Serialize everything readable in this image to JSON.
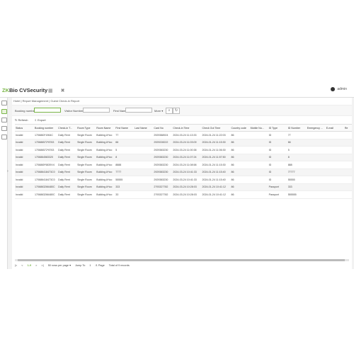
{
  "app": {
    "brand_zk": "ZK",
    "brand_rest": "Bio CVSecurity"
  },
  "topbar": {
    "icon_grid": "▦",
    "icon_tools": "✖",
    "user": "admin"
  },
  "breadcrumb": "Hotel | Report Management | Guest Check-in Report",
  "filters": {
    "booking_label": "Booking number",
    "visitor_label": "Visitor Number",
    "name_label": "First Name",
    "more_label": "More ▾",
    "search_icon": "⌕",
    "refresh_icon": "↻"
  },
  "actions": {
    "refresh": "Refresh",
    "export": "Export"
  },
  "table": {
    "columns": [
      "Status",
      "Booking number",
      "Check-in T...",
      "Room Type",
      "Room Name",
      "First Name",
      "Last Name",
      "Card No",
      "Check-in Time",
      "Check Out Time",
      "Country code",
      "Mobile Nu...",
      "ID Type",
      "ID Number",
      "Emergency ...",
      "E-mail",
      "Re"
    ],
    "rows": [
      [
        "Invalid",
        "1706863*1964C",
        "Daily Rent",
        "Single Room",
        "Building A*loo",
        "77",
        "",
        "2929388924",
        "2024-03-24 11:13:33",
        "2024-01-24 11:22:03",
        "86",
        "",
        "ID",
        "77",
        "",
        "",
        ""
      ],
      [
        "Invalid",
        "170686572*8763",
        "Daily Rent",
        "Single Room",
        "Building A*loo",
        "66",
        "",
        "2929228222",
        "2024-03-24 11:03:09",
        "2024-01-24 11:15:30",
        "86",
        "",
        "ID",
        "66",
        "",
        "",
        ""
      ],
      [
        "Invalid",
        "170686572*8763",
        "Daily Rent",
        "Single Room",
        "Building A*loo",
        "5",
        "",
        "2929383230",
        "2024-03-24 11:00:38",
        "2024-01-24 11:06:30",
        "86",
        "",
        "ID",
        "5",
        "",
        "",
        ""
      ],
      [
        "Invalid",
        "1706864583320",
        "Daily Rent",
        "Single Room",
        "Building A*loo",
        "8",
        "",
        "2929383230",
        "2024-03-24 11:07:24",
        "2024-01-24 11:57:50",
        "86",
        "",
        "ID",
        "8",
        "",
        "",
        ""
      ],
      [
        "Invalid",
        "1706865*5839V4",
        "Daily Rent",
        "Single Room",
        "Building A*loo",
        "8888",
        "",
        "2929383230",
        "2024-03-24 11:08:58",
        "2024-01-24 11:15:30",
        "86",
        "",
        "ID",
        "888",
        "",
        "",
        ""
      ],
      [
        "Invalid",
        "170686418473C0",
        "Daily Rent",
        "Single Room",
        "Building A*loo",
        "7777",
        "",
        "2929383230",
        "2024-03-24 10:41:33",
        "2024-01-24 11:15:40",
        "86",
        "",
        "ID",
        "77777",
        "",
        "",
        ""
      ],
      [
        "Invalid",
        "170686418473C0",
        "Daily Rent",
        "Single Room",
        "Building A*loo",
        "55555",
        "",
        "2929383230",
        "2024-03-24 10:41:33",
        "2024-01-24 11:15:40",
        "86",
        "",
        "ID",
        "55555",
        "",
        "",
        ""
      ],
      [
        "Invalid",
        "1706863266480C",
        "Daily Rent",
        "Single Room",
        "Building A*loo",
        "333",
        "",
        "2793327782",
        "2024-03-24 10:28:03",
        "2024-01-24 10:41:12",
        "86",
        "",
        "Passport",
        "333",
        "",
        "",
        ""
      ],
      [
        "Invalid",
        "1706863266480C",
        "Daily Rent",
        "Single Room",
        "Building A*loo",
        "33",
        "",
        "2793327782",
        "2024-03-24 10:28:03",
        "2024-01-24 10:41:12",
        "86",
        "",
        "Passport",
        "555555",
        "",
        "",
        ""
      ]
    ]
  },
  "pager": {
    "first": "|<",
    "prev": "<",
    "page": "1-9",
    "next": ">",
    "last": ">|",
    "per_page": "50 rows per page ▾",
    "jump_label": "Jump To",
    "jump_value": "1",
    "page_label": "/1 Page",
    "total": "Total of 9 records"
  }
}
